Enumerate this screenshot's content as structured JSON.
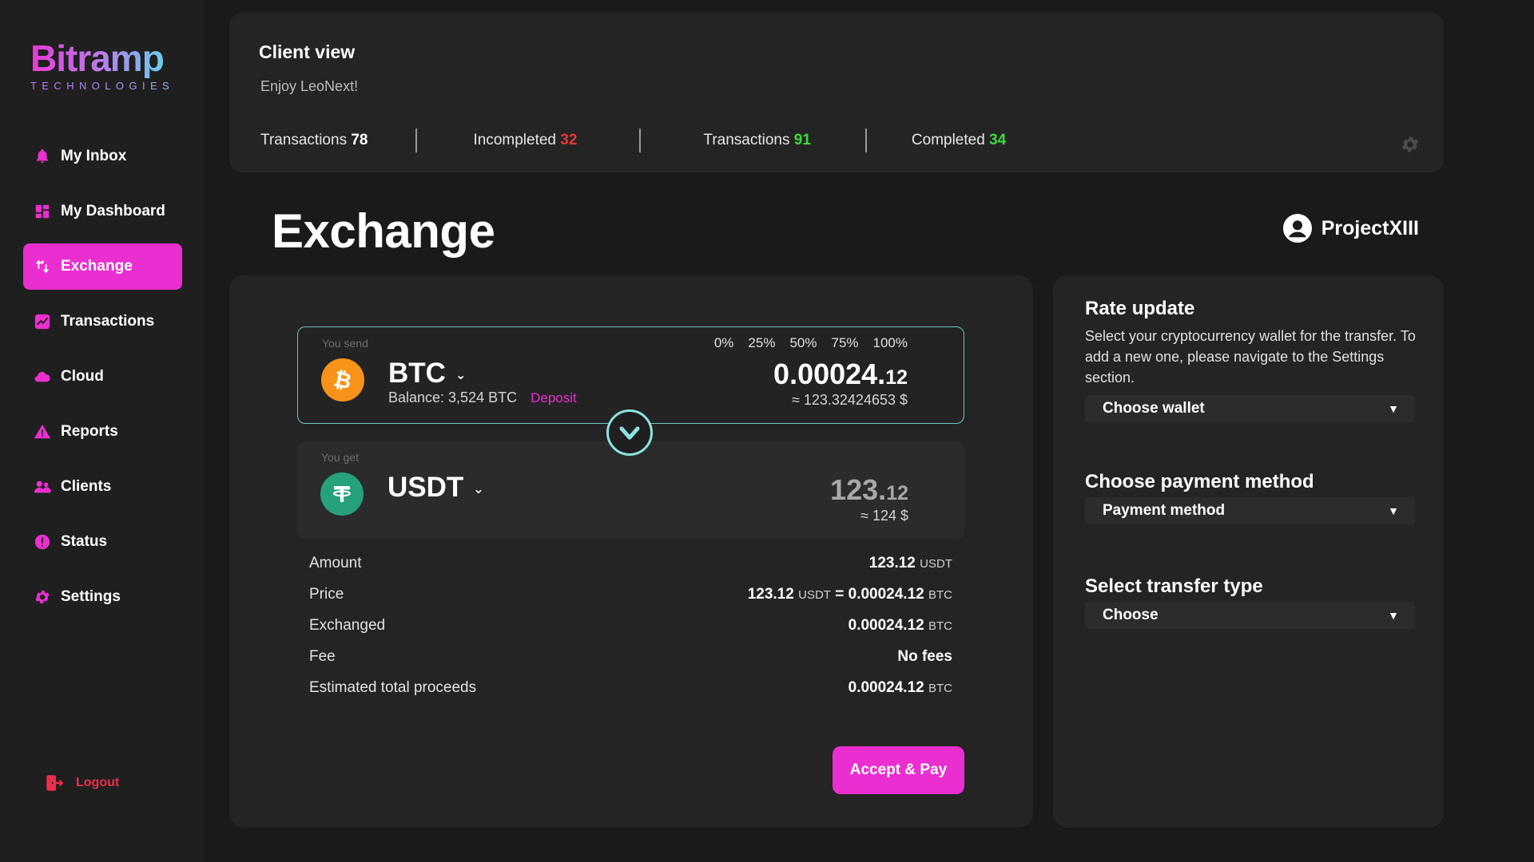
{
  "brand": {
    "name": "Bitramp",
    "tagline": "TECHNOLOGIES"
  },
  "sidebar": {
    "items": [
      {
        "label": "My Inbox",
        "icon": "bell-icon"
      },
      {
        "label": "My Dashboard",
        "icon": "grid-icon"
      },
      {
        "label": "Exchange",
        "icon": "exchange-icon",
        "active": true
      },
      {
        "label": "Transactions",
        "icon": "chart-icon"
      },
      {
        "label": "Cloud",
        "icon": "cloud-icon"
      },
      {
        "label": "Reports",
        "icon": "warning-icon"
      },
      {
        "label": "Clients",
        "icon": "users-icon"
      },
      {
        "label": "Status",
        "icon": "alert-circle-icon"
      },
      {
        "label": "Settings",
        "icon": "gear-icon"
      }
    ],
    "logout": "Logout"
  },
  "header": {
    "title": "Client view",
    "subtitle": "Enjoy LeoNext!",
    "stats": [
      {
        "label": "Transactions",
        "value": "78",
        "color": "#ffffff"
      },
      {
        "label": "Incompleted",
        "value": "32",
        "color": "#e53935"
      },
      {
        "label": "Transactions",
        "value": "91",
        "color": "#3ddc3d"
      },
      {
        "label": "Completed",
        "value": "34",
        "color": "#3ddc3d"
      }
    ]
  },
  "page": {
    "title": "Exchange",
    "user": "ProjectXIII"
  },
  "exchange": {
    "send": {
      "label": "You send",
      "coin": "BTC",
      "balance": "Balance: 3,524 BTC",
      "deposit": "Deposit",
      "percents": [
        "0%",
        "25%",
        "50%",
        "75%",
        "100%"
      ],
      "amount_main": "0.00024.",
      "amount_small": "12",
      "approx": "≈ 123.32424653 $"
    },
    "get": {
      "label": "You get",
      "coin": "USDT",
      "amount_main": "123.",
      "amount_small": "12",
      "approx": "≈ 124 $"
    },
    "details": {
      "amount_label": "Amount",
      "amount_value": "123.12",
      "amount_unit": "USDT",
      "price_label": "Price",
      "price_left": "123.12",
      "price_left_unit": "USDT",
      "price_eq": "=",
      "price_right": "0.00024.12",
      "price_right_unit": "BTC",
      "exchanged_label": "Exchanged",
      "exchanged_value": "0.00024.12",
      "exchanged_unit": "BTC",
      "fee_label": "Fee",
      "fee_value": "No fees",
      "total_label": "Estimated total proceeds",
      "total_value": "0.00024.12",
      "total_unit": "BTC"
    },
    "accept_label": "Accept & Pay"
  },
  "right": {
    "rate_title": "Rate update",
    "rate_desc": "Select your cryptocurrency wallet for the transfer. To add a new one, please navigate to the Settings section.",
    "wallet_select": "Choose wallet",
    "payment_title": "Choose payment method",
    "payment_select": "Payment method",
    "transfer_title": "Select transfer type",
    "transfer_select": "Choose"
  },
  "colors": {
    "accent": "#ea2ed0",
    "teal": "#6dc7c2",
    "btc": "#f7931a",
    "usdt": "#26a17b"
  }
}
